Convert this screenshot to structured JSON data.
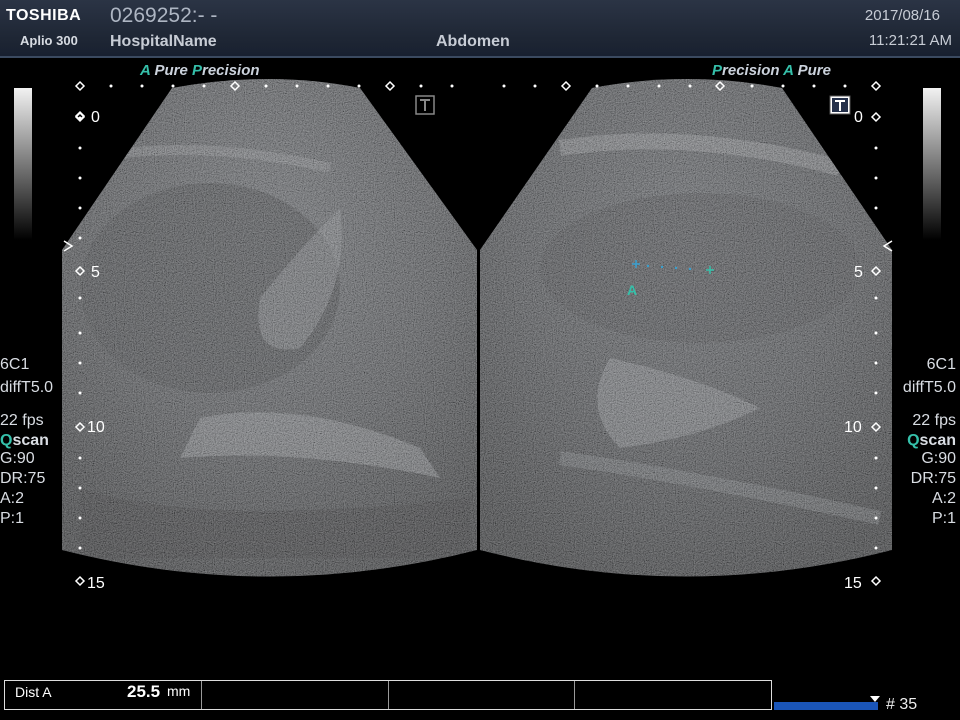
{
  "header": {
    "brand": "TOSHIBA",
    "model": "Aplio 300",
    "patient_id": "0269252:- -",
    "hospital": "HospitalName",
    "exam": "Abdomen",
    "date": "2017/08/16",
    "time": "11:21:21 AM"
  },
  "left_pane": {
    "tag_a": "A",
    "tag_pure": "Pure",
    "tag_p": "P",
    "tag_precision": "recision",
    "transducer": "6C1",
    "mode": "diffT5.0",
    "fps": "22 fps",
    "qscan_q": "Q",
    "qscan_rest": "scan",
    "gain": "G:90",
    "dynamic_range": "DR:75",
    "a": "A:2",
    "p": "P:1"
  },
  "right_pane": {
    "tag_p": "P",
    "tag_precision": "recision",
    "tag_a": "A",
    "tag_pure": "Pure",
    "transducer": "6C1",
    "mode": "diffT5.0",
    "fps": "22 fps",
    "qscan_q": "Q",
    "qscan_rest": "scan",
    "gain": "G:90",
    "dynamic_range": "DR:75",
    "a": "A:2",
    "p": "P:1"
  },
  "depth_labels": [
    "0",
    "5",
    "10",
    "15"
  ],
  "caliper_label": "A",
  "measurement": {
    "label": "Dist A",
    "value": "25.5",
    "unit": "mm"
  },
  "frame_number": "# 35",
  "colors": {
    "accent": "#35c0aa",
    "header_bg": "#1e2634",
    "caliper": "#3aa0d0",
    "frame_bar": "#1a55b8"
  }
}
